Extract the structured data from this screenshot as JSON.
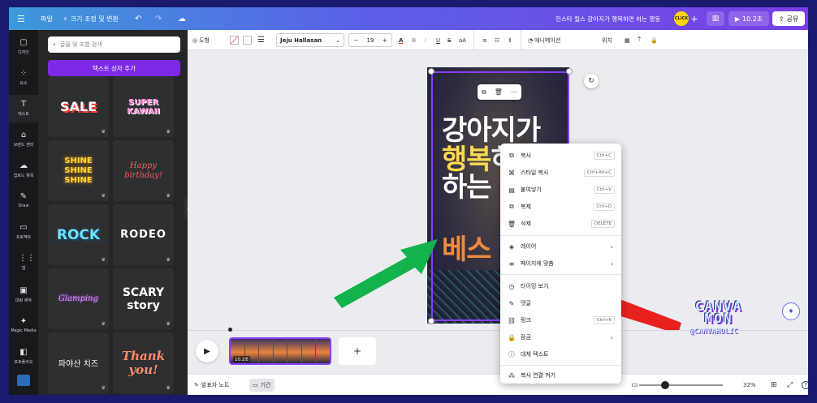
{
  "topbar": {
    "menu_icon": "hamburger-icon",
    "file_label": "파일",
    "resize_label": "크기 조정 및 변환",
    "title": "인스타 릴스 강아지가 행복하면 하는 행동",
    "user_badge": "CLICK",
    "plus": "+",
    "play_label": "10.2초",
    "share_label": "공유",
    "accent": "#8b3dff"
  },
  "leftnav": {
    "items": [
      {
        "icon": "▢",
        "label": "디자인"
      },
      {
        "icon": "⁘",
        "label": "요소"
      },
      {
        "icon": "T",
        "label": "텍스트"
      },
      {
        "icon": "⌂",
        "label": "브랜드 센터"
      },
      {
        "icon": "☁",
        "label": "업로드 항목"
      },
      {
        "icon": "✎",
        "label": "Draw"
      },
      {
        "icon": "▭",
        "label": "프로젝트"
      },
      {
        "icon": "⋮⋮",
        "label": "앱"
      },
      {
        "icon": "▣",
        "label": "대량 제작"
      },
      {
        "icon": "✦",
        "label": "Magic Media"
      },
      {
        "icon": "◧",
        "label": "포토플리오"
      }
    ]
  },
  "panel": {
    "search_placeholder": "글꼴 및 조합 검색",
    "add_text_button": "텍스트 상자 추가",
    "tiles": [
      {
        "text": "SALE",
        "color": "#ffffff"
      },
      {
        "text": "SUPER KAWAII",
        "color": "#ff8ad1"
      },
      {
        "text": "SHINE SHINE SHINE",
        "color": "#ffd83a"
      },
      {
        "text": "Happy birthday!",
        "color": "#ff5a5a"
      },
      {
        "text": "ROCK",
        "color": "#6fe0ff"
      },
      {
        "text": "RODEO",
        "color": "#ffffff"
      },
      {
        "text": "Glamping",
        "color": "#e49cff"
      },
      {
        "text": "SCARY story",
        "color": "#ffffff"
      },
      {
        "text": "파야산 치즈",
        "color": "#ffffff"
      },
      {
        "text": "Thank you!",
        "color": "#ff8a6a"
      }
    ]
  },
  "toolbar": {
    "shape_label": "도형",
    "font_name": "Jeju Hallasan",
    "font_size": "19",
    "minus": "−",
    "plus": "+",
    "animate_label": "애니메이션",
    "position_label": "위치"
  },
  "design": {
    "line1": "강아지가",
    "line2a": "행복",
    "line2b": "하면",
    "line3": "하는",
    "line4": "베스"
  },
  "context_menu": {
    "items": [
      {
        "icon": "⧉",
        "label": "복사",
        "shortcut": "Ctrl+C"
      },
      {
        "icon": "⌘",
        "label": "스타일 복사",
        "shortcut": "Ctrl+Alt+C"
      },
      {
        "icon": "▤",
        "label": "붙여넣기",
        "shortcut": "Ctrl+V"
      },
      {
        "icon": "⧉",
        "label": "복제",
        "shortcut": "Ctrl+D"
      },
      {
        "icon": "🗑",
        "label": "삭제",
        "shortcut": "DELETE"
      },
      {
        "icon": "◈",
        "label": "레이어",
        "arrow": "›"
      },
      {
        "icon": "≡",
        "label": "페이지에 맞춤",
        "arrow": "›"
      },
      {
        "icon": "◷",
        "label": "타이밍 보기"
      },
      {
        "icon": "✎",
        "label": "댓글"
      },
      {
        "icon": "⛓",
        "label": "링크",
        "shortcut": "Ctrl+K"
      },
      {
        "icon": "🔒",
        "label": "잠금",
        "arrow": "›"
      },
      {
        "icon": "ⓘ",
        "label": "대체 텍스트"
      },
      {
        "icon": "⁂",
        "label": "복사 연결 켜기"
      }
    ]
  },
  "timeline": {
    "clip_duration": "10.2초",
    "add_label": "+"
  },
  "bottombar": {
    "notes_label": "발표자 노트",
    "duration_label": "기간",
    "zoom": "32%",
    "help": "?"
  },
  "watermark": {
    "line1": "CANVA",
    "line2": "MON",
    "handle": "@CANVAHOLIC"
  }
}
